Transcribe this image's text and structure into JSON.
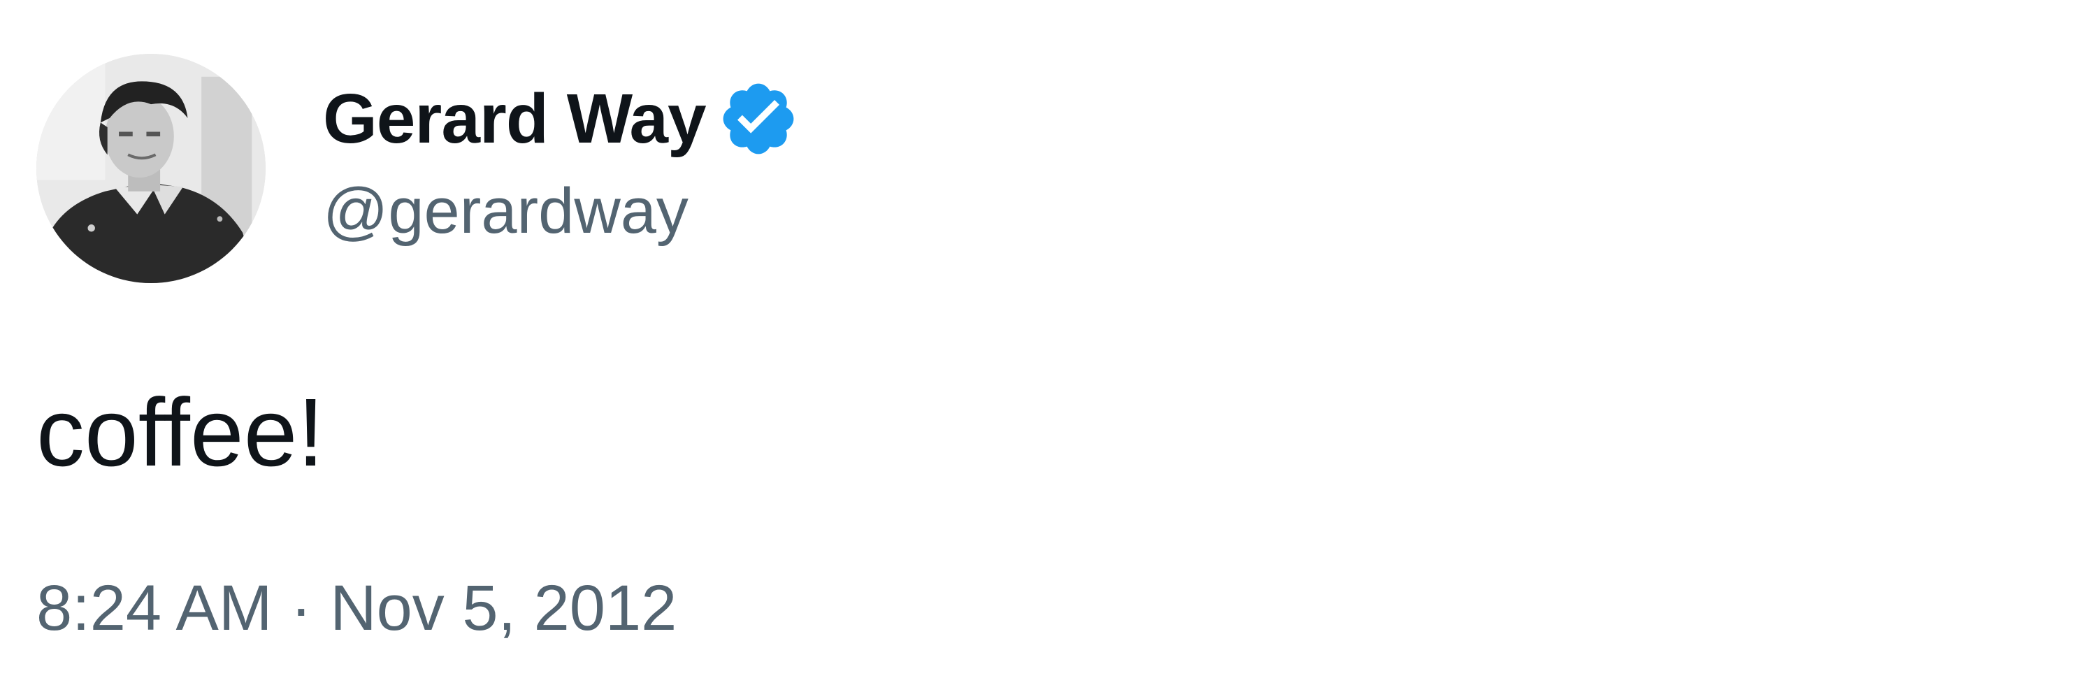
{
  "author": {
    "display_name": "Gerard Way",
    "handle": "@gerardway",
    "verified": true,
    "avatar_icon": "profile-photo",
    "badge_icon": "verified-badge-icon",
    "badge_color": "#1d9bf0"
  },
  "tweet": {
    "text": "coffee!",
    "time": "8:24 AM",
    "separator": "·",
    "date": "Nov 5, 2012"
  },
  "colors": {
    "text_primary": "#0f1419",
    "text_secondary": "#536471",
    "background": "#ffffff"
  }
}
